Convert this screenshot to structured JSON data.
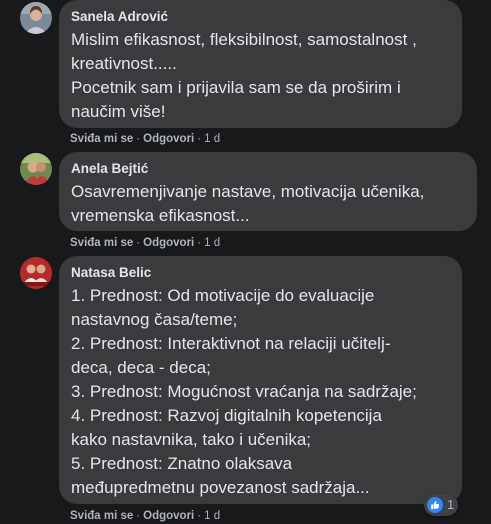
{
  "comments": [
    {
      "author": "Sanela Adrović",
      "lines": [
        "Mislim efikasnost, fleksibilnost, samostalnost ,",
        "kreativnost.....",
        "Pocetnik sam i prijavila sam se da proširim i",
        "naučim više!"
      ],
      "like_label": "Sviđa mi se",
      "reply_label": "Odgovori",
      "time": "1 d"
    },
    {
      "author": "Anela Bejtić",
      "lines": [
        "Osavremenjivanje nastave, motivacija učenika,",
        "vremenska efikasnost..."
      ],
      "like_label": "Sviđa mi se",
      "reply_label": "Odgovori",
      "time": "1 d"
    },
    {
      "author": "Natasa Belic",
      "lines": [
        "1. Prednost: Od motivacije do evaluacije",
        "nastavnog časa/teme;",
        "2. Prednost: Interaktivnot na relaciji učiteǉ-",
        "deca, deca - deca;",
        "3. Prednost: Mogućnost vraćanja na sadržaje;",
        "4. Prednost: Razvoj digitalnih kopetencija",
        "kako nastavnika, tako i učenika;",
        "5. Prednost: Znatno olaksava",
        "međupredmetnu povezanost sadržaja..."
      ],
      "like_label": "Sviđa mi se",
      "reply_label": "Odgovori",
      "time": "1 d",
      "reaction": {
        "icon": "like-icon",
        "count": "1",
        "color": "#2d88ff"
      }
    }
  ],
  "separator": "·",
  "colors": {
    "background": "#18191a",
    "bubble": "#3a3b3c",
    "primary_text": "#e4e6eb",
    "secondary_text": "#b0b3b8",
    "like_blue": "#2d88ff"
  }
}
